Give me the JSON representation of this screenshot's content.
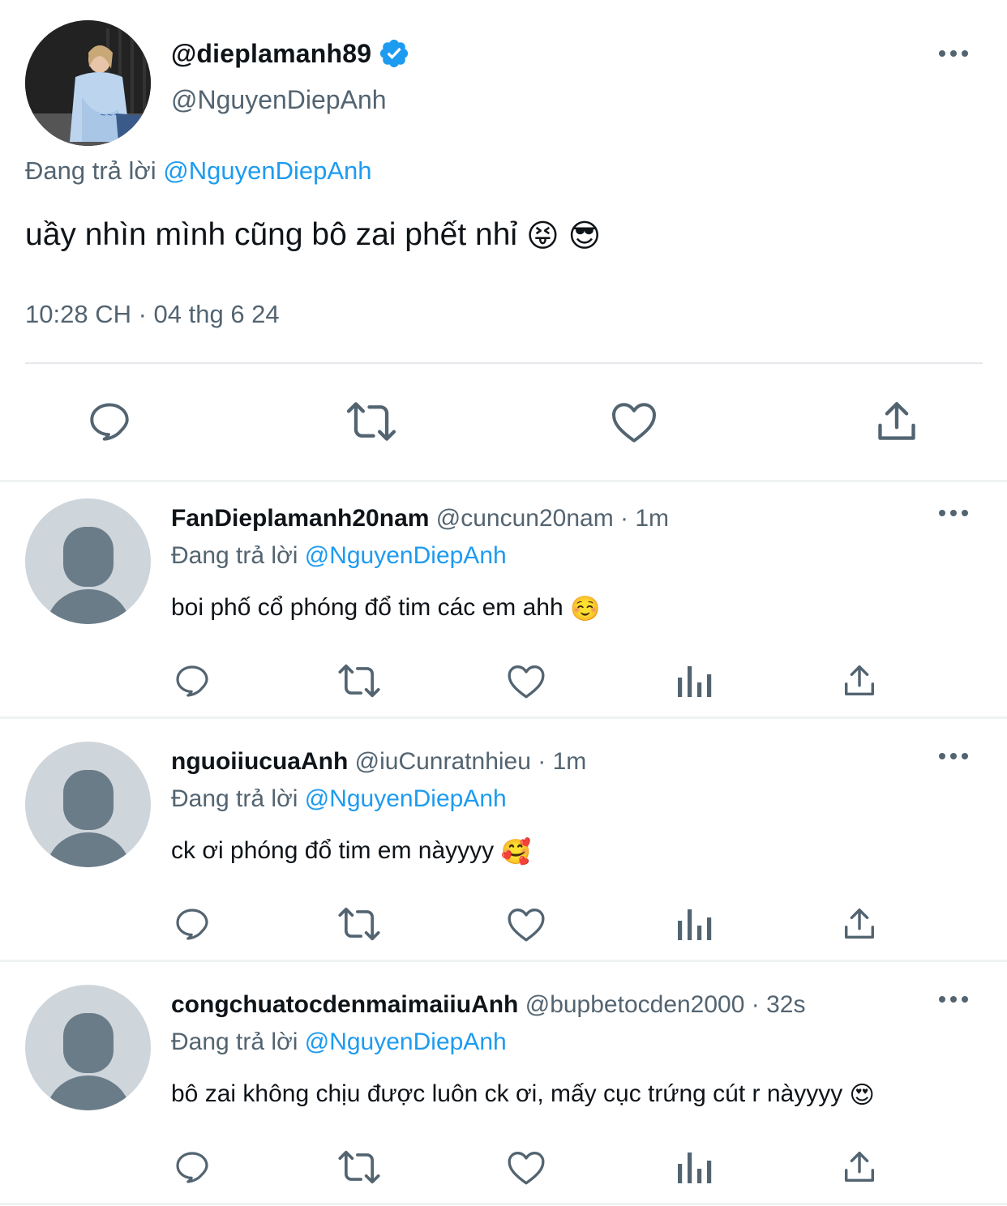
{
  "main_tweet": {
    "display_name": "@dieplamanh89",
    "handle": "@NguyenDiepAnh",
    "replying_prefix": "Đang trả lời",
    "replying_to": "@NguyenDiepAnh",
    "text": "uầy nhìn mình cũng bô zai phết nhỉ",
    "emojis": [
      "😝",
      "😎"
    ],
    "timestamp": "10:28 CH · 04 thg 6 24",
    "icons": [
      "reply-icon",
      "retweet-icon",
      "like-icon",
      "share-icon"
    ]
  },
  "replies": [
    {
      "display_name": "FanDieplamanh20nam",
      "meta": "@cuncun20nam · 1m",
      "replying_prefix": "Đang trả lời",
      "replying_to": "@NguyenDiepAnh",
      "text": "boi phố cổ phóng đổ tim các em ahh",
      "emoji": "☺️"
    },
    {
      "display_name": "nguoiiucuaAnh",
      "meta": "@iuCunratnhieu · 1m",
      "replying_prefix": "Đang trả lời",
      "replying_to": "@NguyenDiepAnh",
      "text": "ck ơi phóng đổ tim em nàyyyy",
      "emoji": "🥰"
    },
    {
      "display_name": "congchuatocdenmaimaiiuAnh",
      "meta": "@bupbetocden2000 · 32s",
      "replying_prefix": "Đang trả lời",
      "replying_to": "@NguyenDiepAnh",
      "text": "bô zai không chịu được luôn ck ơi, mấy cục trứng cút r nàyyyy",
      "emoji": "😍"
    }
  ],
  "colors": {
    "accent": "#1d9bf0",
    "secondary_text": "#536471",
    "primary_text": "#0f1419",
    "divider": "#eff3f4",
    "avatar_placeholder_bg": "#ced5db",
    "avatar_placeholder_fg": "#6b7c89"
  }
}
